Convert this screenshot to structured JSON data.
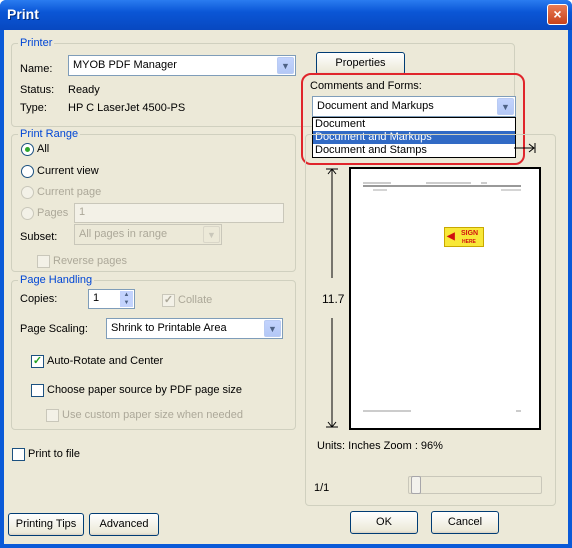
{
  "window": {
    "title": "Print",
    "close_glyph": "×"
  },
  "printer": {
    "legend": "Printer",
    "name_label": "Name:",
    "name_value": "MYOB PDF Manager",
    "status_label": "Status:",
    "status_value": "Ready",
    "type_label": "Type:",
    "type_value": "HP C LaserJet 4500-PS",
    "properties_label": "Properties"
  },
  "comments": {
    "label": "Comments and Forms:",
    "selected": "Document and Markups",
    "options": [
      "Document",
      "Document and Markups",
      "Document and Stamps"
    ],
    "highlighted_index": 1
  },
  "print_range": {
    "legend": "Print Range",
    "all_label": "All",
    "current_view_label": "Current view",
    "current_page_label": "Current page",
    "pages_label": "Pages",
    "pages_value": "1",
    "subset_label": "Subset:",
    "subset_value": "All pages in range",
    "reverse_label": "Reverse pages",
    "selected": "All"
  },
  "page_handling": {
    "legend": "Page Handling",
    "copies_label": "Copies:",
    "copies_value": "1",
    "collate_label": "Collate",
    "scaling_label": "Page Scaling:",
    "scaling_value": "Shrink to Printable Area",
    "auto_rotate_label": "Auto-Rotate and Center",
    "auto_rotate_checked": true,
    "paper_source_label": "Choose paper source by PDF page size",
    "paper_source_checked": false,
    "custom_paper_label": "Use custom paper size when needed"
  },
  "print_to_file_label": "Print to file",
  "preview": {
    "height_label": "11.7",
    "units_zoom": "Units: Inches Zoom :  96%",
    "page_indicator": "1/1",
    "sign_here_line1": "SIGN",
    "sign_here_line2": "HERE"
  },
  "buttons": {
    "printing_tips": "Printing Tips",
    "advanced": "Advanced",
    "ok": "OK",
    "cancel": "Cancel"
  },
  "icons": {
    "dropdown_arrow": "chevron-down-icon",
    "spin_up": "spin-up-icon",
    "spin_down": "spin-down-icon",
    "checkmark": "checkmark-icon"
  },
  "colors": {
    "titlebar": "#0a56d6",
    "dialog_bg": "#ece9d8",
    "legend_text": "#0046d5",
    "selection": "#316ac5",
    "annotation_ring": "#e0252b"
  }
}
